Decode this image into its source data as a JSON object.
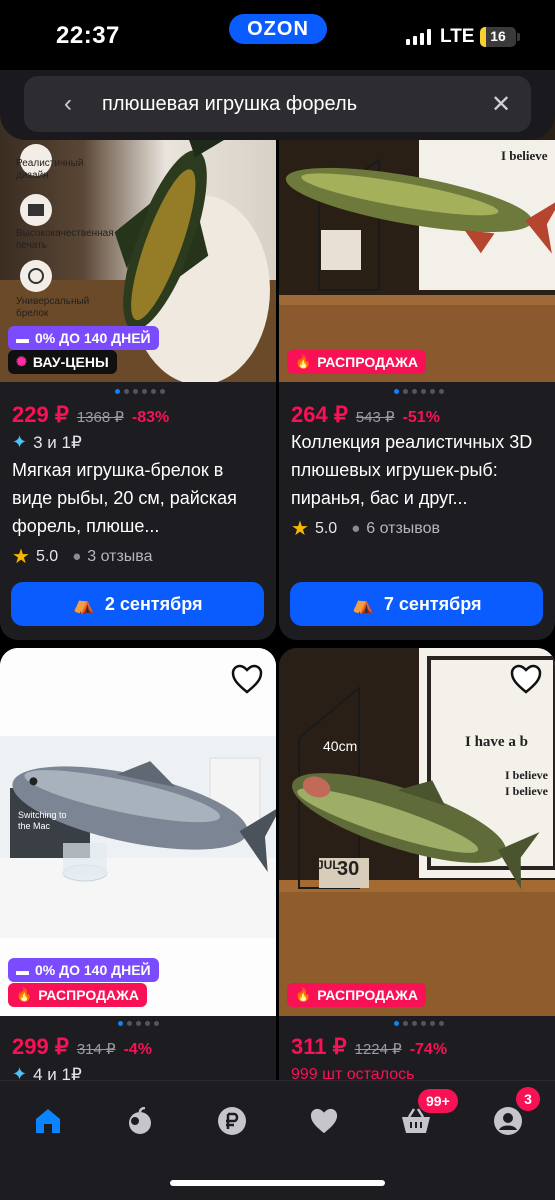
{
  "status_bar": {
    "time": "22:37",
    "app_logo": "OZON",
    "network": "LTE",
    "battery": "16",
    "battery_level": 0.16
  },
  "search": {
    "back_icon": "back-arrow-icon",
    "query": "плюшевая игрушка форель",
    "clear_icon": "close-icon"
  },
  "products": [
    {
      "image_features": [
        "Реалистичный дизайн",
        "Высококачественная печать",
        "Универсальный брелок"
      ],
      "badges": [
        {
          "text": "0% ДО 140 ДНЕЙ",
          "icon": "card-icon",
          "color": "#7b4bff"
        },
        {
          "text": "ВАУ-ЦЕНЫ",
          "icon": "sparkle-icon",
          "color": "#101010"
        }
      ],
      "price": "229 ₽",
      "old_price": "1368 ₽",
      "discount": "-83%",
      "points": "3 и 1₽",
      "title": "Мягкая игрушка-брелок в виде рыбы, 20 см, райская форель, плюше...",
      "rating": "5.0",
      "reviews": "3 отзыва",
      "delivery": "2 сентября"
    },
    {
      "badges": [
        {
          "text": "РАСПРОДАЖА",
          "icon": "fire-icon",
          "color": "#f91155"
        }
      ],
      "image_text": "I believe",
      "price": "264 ₽",
      "old_price": "543 ₽",
      "discount": "-51%",
      "title": "Коллекция реалистичных 3D плюшевых игрушек-рыб: пиранья, бас и друг...",
      "rating": "5.0",
      "reviews": "6 отзывов",
      "delivery": "7 сентября"
    },
    {
      "badges": [
        {
          "text": "0% ДО 140 ДНЕЙ",
          "icon": "card-icon",
          "color": "#7b4bff"
        },
        {
          "text": "РАСПРОДАЖА",
          "icon": "fire-icon",
          "color": "#f91155"
        }
      ],
      "image_text": "Switching to the Mac",
      "price": "299 ₽",
      "old_price": "314 ₽",
      "discount": "-4%",
      "points": "4 и 1₽"
    },
    {
      "badges": [
        {
          "text": "РАСПРОДАЖА",
          "icon": "fire-icon",
          "color": "#f91155"
        }
      ],
      "image_text": [
        "40cm",
        "I have a b",
        "I believe",
        "I believe",
        "JUL",
        "30"
      ],
      "price": "311 ₽",
      "old_price": "1224 ₽",
      "discount": "-74%",
      "stock": "999 шт осталось"
    }
  ],
  "bottom_nav": {
    "items": [
      "home-icon",
      "fresh-apple-icon",
      "ruble-icon",
      "heart-icon",
      "cart-icon",
      "profile-icon"
    ],
    "cart_badge": "99+",
    "profile_badge": "3",
    "active": "home-icon"
  },
  "colors": {
    "accent": "#0a5cff",
    "price": "#f91155",
    "background": "#000000",
    "card": "#1c1c21"
  }
}
